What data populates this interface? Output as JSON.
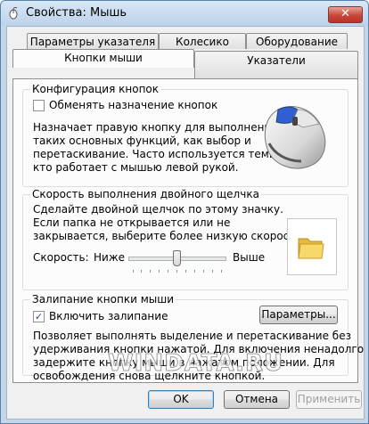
{
  "window": {
    "title": "Свойства: Мышь",
    "close_symbol": "✕"
  },
  "tabs": {
    "row1": [
      "Параметры указателя",
      "Колесико",
      "Оборудование"
    ],
    "row2": [
      "Кнопки мыши",
      "Указатели"
    ],
    "active": "Кнопки мыши"
  },
  "button_config": {
    "title": "Конфигурация кнопок",
    "swap_label": "Обменять назначение кнопок",
    "swap_checked": false,
    "description": [
      "Назначает правую кнопку для выполнения",
      "таких основных функций, как выбор и",
      "перетаскивание. Часто используется теми,",
      "кто работает с мышью левой рукой."
    ]
  },
  "double_click": {
    "title": "Скорость выполнения двойного щелчка",
    "description": [
      "Сделайте двойной щелчок по этому значку.",
      "Если папка не открывается или не",
      "закрывается, выберите более низкую скорость."
    ],
    "speed_label": "Скорость:",
    "slow_label": "Ниже",
    "fast_label": "Выше",
    "speed_fraction": 0.5
  },
  "click_lock": {
    "title": "Залипание кнопки мыши",
    "enable_label": "Включить залипание",
    "enable_checked": true,
    "settings_button": "Параметры...",
    "description": [
      "Позволяет выполнять выделение и перетаскивание без",
      "удерживания кнопки нажатой. Для включения ненадолго",
      "задержите кнопку мыши в нажатом положении. Для",
      "освобождения снова щелкните кнопкой."
    ]
  },
  "footer": {
    "ok": "OK",
    "cancel": "Отмена",
    "apply": "Применить"
  },
  "watermark": "WINDATA.RU",
  "checkmark": "✓"
}
